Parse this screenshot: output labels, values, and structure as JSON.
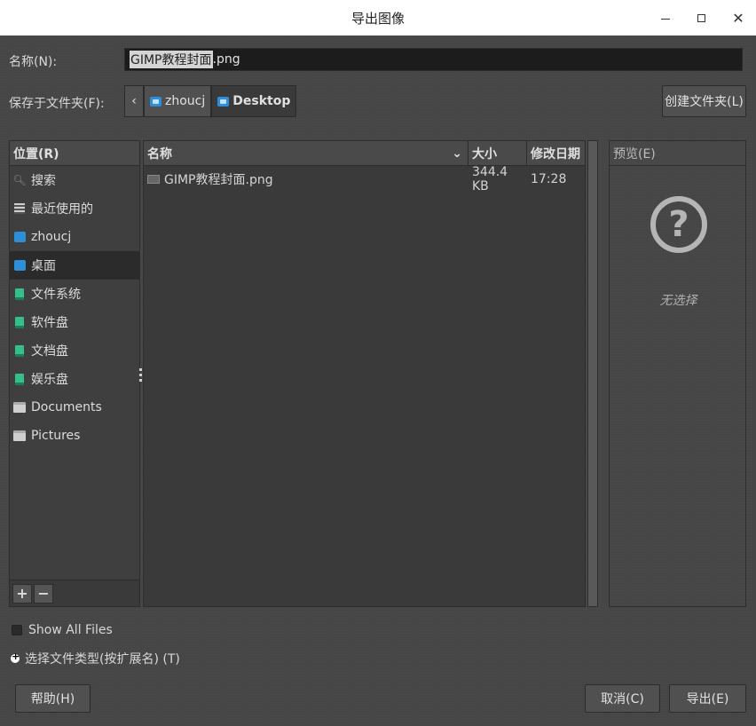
{
  "window": {
    "title": "导出图像"
  },
  "form": {
    "name_label": "名称(N):",
    "filename_selected": "GIMP教程封面",
    "filename_ext": ".png",
    "save_in_label": "保存于文件夹(F):",
    "path": [
      "zhoucj",
      "Desktop"
    ],
    "create_folder_label": "创建文件夹(L)"
  },
  "places": {
    "header": "位置(R)",
    "items": [
      {
        "label": "搜索",
        "icon": "search-icon"
      },
      {
        "label": "最近使用的",
        "icon": "recent-icon"
      },
      {
        "label": "zhoucj",
        "icon": "home-folder-icon"
      },
      {
        "label": "桌面",
        "icon": "desktop-folder-icon"
      },
      {
        "label": "文件系统",
        "icon": "drive-icon"
      },
      {
        "label": "软件盘",
        "icon": "drive-icon"
      },
      {
        "label": "文档盘",
        "icon": "drive-icon"
      },
      {
        "label": "娱乐盘",
        "icon": "drive-icon"
      },
      {
        "label": "Documents",
        "icon": "folder-icon"
      },
      {
        "label": "Pictures",
        "icon": "folder-icon"
      }
    ],
    "add_label": "+",
    "remove_label": "−"
  },
  "files": {
    "columns": {
      "name": "名称",
      "size": "大小",
      "date": "修改日期"
    },
    "rows": [
      {
        "name": "GIMP教程封面.png",
        "size": "344.4 KB",
        "date": "17:28"
      }
    ]
  },
  "preview": {
    "header": "预览(E)",
    "empty_text": "无选择"
  },
  "options": {
    "show_all_files": "Show All Files",
    "file_type": "选择文件类型(按扩展名) (T)"
  },
  "buttons": {
    "help": "帮助(H)",
    "cancel": "取消(C)",
    "export": "导出(E)"
  }
}
